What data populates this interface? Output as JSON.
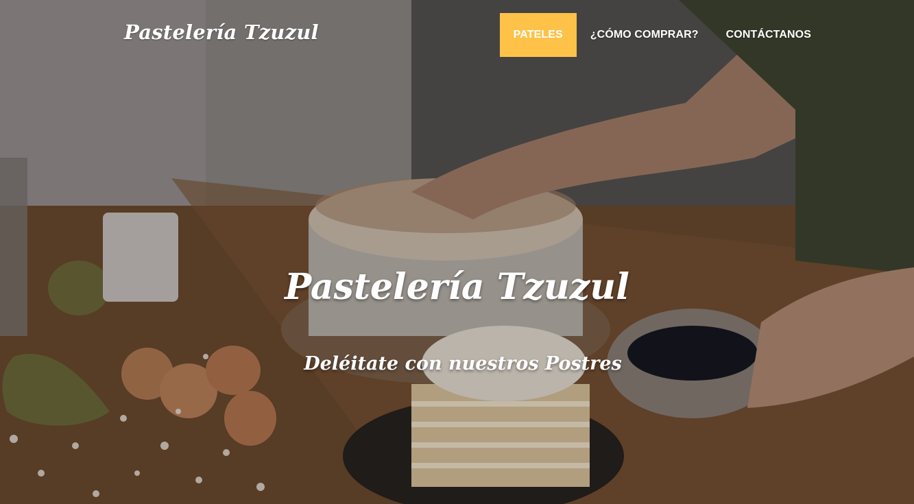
{
  "brand": {
    "name": "Pastelería Tzuzul"
  },
  "nav": {
    "items": [
      {
        "label": "PATELES",
        "active": true
      },
      {
        "label": "¿CÓMO COMPRAR?",
        "active": false
      },
      {
        "label": "CONTÁCTANOS",
        "active": false
      }
    ]
  },
  "hero": {
    "title": "Pastelería Tzuzul",
    "subtitle": "Deléitate con nuestros Postres",
    "background_description_icon": "cake-photo-icon"
  },
  "colors": {
    "accent": "#fec248",
    "text": "#ffffff"
  }
}
